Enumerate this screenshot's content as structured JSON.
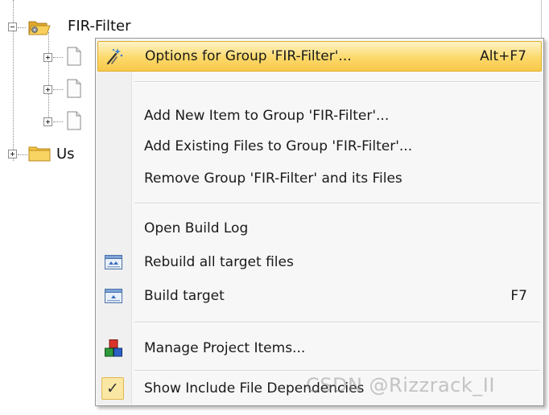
{
  "tree": {
    "group_label": "FIR-Filter",
    "user_group_label": "Us"
  },
  "context_menu": {
    "items": [
      {
        "label": "Options for Group 'FIR-Filter'...",
        "shortcut": "Alt+F7",
        "icon": "options-wand-icon"
      },
      {
        "label": "Add New  Item to Group 'FIR-Filter'...",
        "shortcut": ""
      },
      {
        "label": "Add Existing Files to Group 'FIR-Filter'...",
        "shortcut": ""
      },
      {
        "label": "Remove Group 'FIR-Filter' and its Files",
        "shortcut": ""
      },
      {
        "label": "Open Build Log",
        "shortcut": ""
      },
      {
        "label": "Rebuild all target files",
        "shortcut": "",
        "icon": "rebuild-icon"
      },
      {
        "label": "Build target",
        "shortcut": "F7",
        "icon": "build-icon"
      },
      {
        "label": "Manage Project Items...",
        "shortcut": "",
        "icon": "manage-project-items-icon"
      },
      {
        "label": "Show Include File Dependencies",
        "shortcut": "",
        "icon": "checkmark-icon"
      }
    ]
  },
  "watermark": "CSDN @Rizzrack_II",
  "colors": {
    "highlight": "#fcd96a",
    "menu_background": "#f7f7f7",
    "folder": "#f3c445"
  }
}
